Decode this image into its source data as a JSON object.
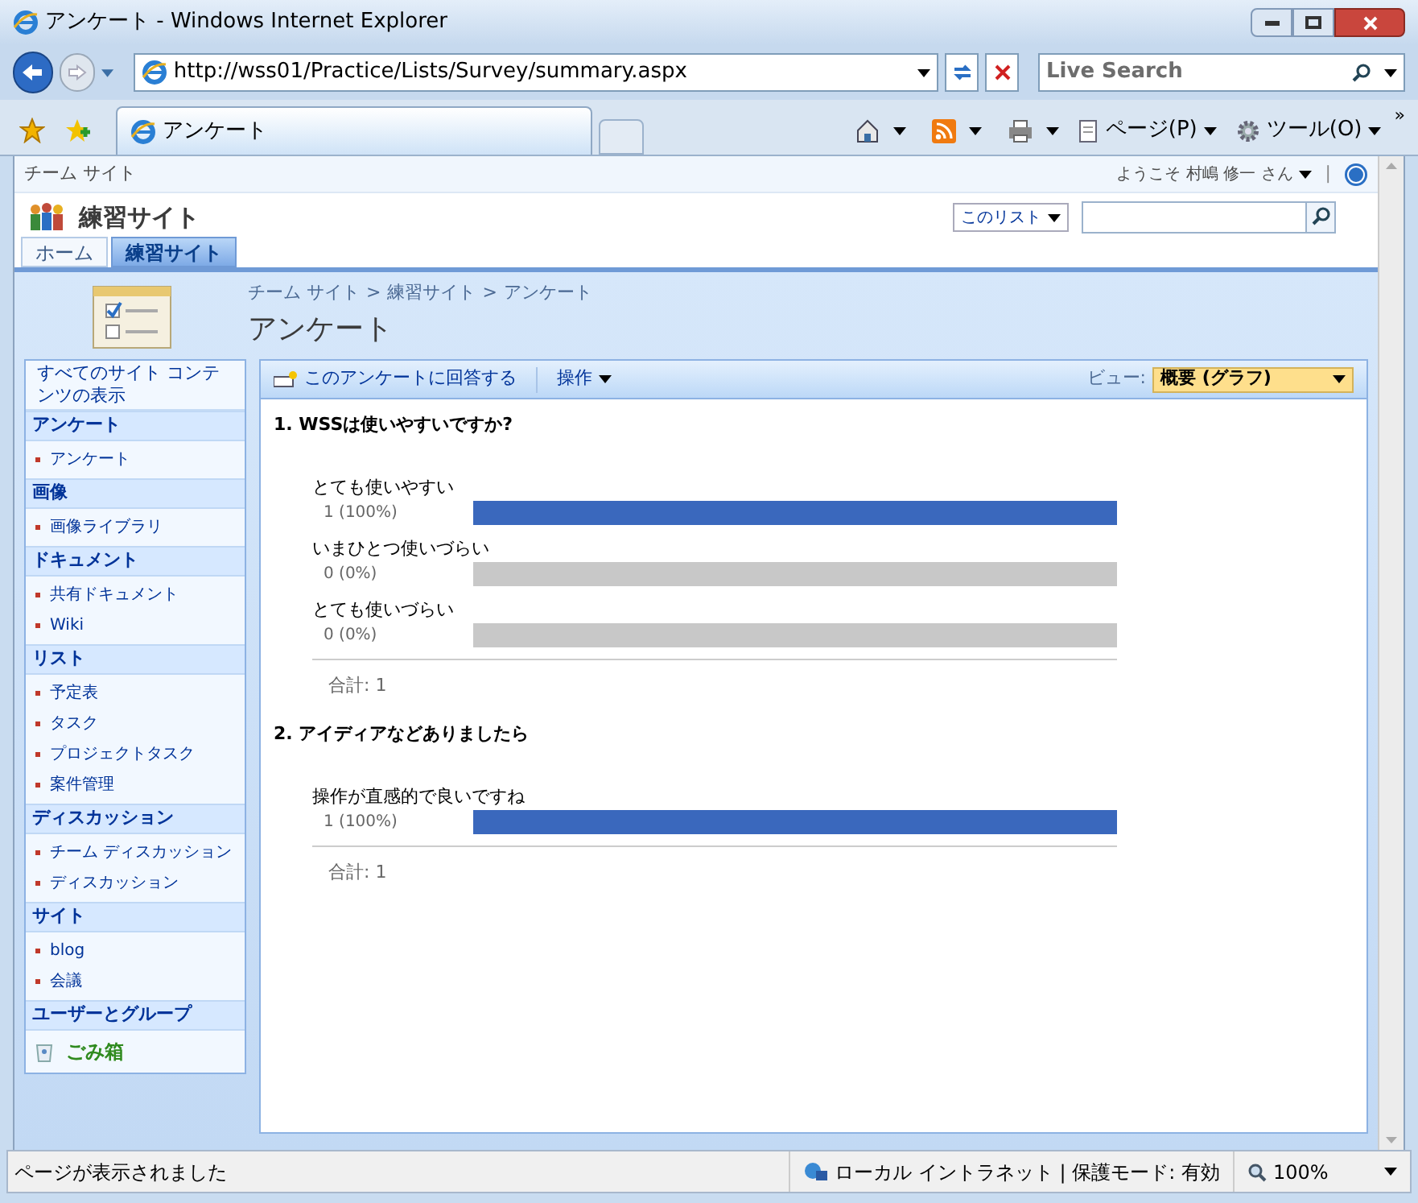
{
  "window": {
    "title": "アンケート - Windows Internet Explorer"
  },
  "browser": {
    "address": "http://wss01/Practice/Lists/Survey/summary.aspx",
    "search_placeholder": "Live Search",
    "tab": "アンケート",
    "page_menu": "ページ(P)",
    "tools_menu": "ツール(O)",
    "more": "»"
  },
  "site": {
    "top_link": "チーム サイト",
    "welcome": "ようこそ 村嶋 修一 さん",
    "welcome_separator": "|",
    "title": "練習サイト",
    "scope": "このリスト",
    "tabs": [
      {
        "label": "ホーム",
        "selected": false
      },
      {
        "label": "練習サイト",
        "selected": true
      }
    ],
    "breadcrumb": [
      "チーム サイト",
      "練習サイト",
      "アンケート"
    ],
    "separator": ">",
    "page_title": "アンケート"
  },
  "sidebar": {
    "view_all": "すべてのサイト コンテンツの表示",
    "sections": [
      {
        "heading": "アンケート",
        "items": [
          "アンケート"
        ]
      },
      {
        "heading": "画像",
        "items": [
          "画像ライブラリ"
        ]
      },
      {
        "heading": "ドキュメント",
        "items": [
          "共有ドキュメント",
          "Wiki"
        ]
      },
      {
        "heading": "リスト",
        "items": [
          "予定表",
          "タスク",
          "プロジェクトタスク",
          "案件管理"
        ]
      },
      {
        "heading": "ディスカッション",
        "items": [
          "チーム ディスカッション",
          "ディスカッション"
        ]
      },
      {
        "heading": "サイト",
        "items": [
          "blog",
          "会議"
        ]
      },
      {
        "heading": "ユーザーとグループ"
      }
    ],
    "recycle_bin": "ごみ箱"
  },
  "toolbar": {
    "respond": "このアンケートに回答する",
    "actions": "操作",
    "view_label": "ビュー:",
    "view_value": "概要 (グラフ)"
  },
  "questions": [
    {
      "title": "1. WSSは使いやすいですか?",
      "total": "合計: 1",
      "answers": [
        {
          "label": "とても使いやすい",
          "count": "1 (100%)",
          "level": 1
        },
        {
          "label": "いまひとつ使いづらい",
          "count": "0 (0%)",
          "level": 0
        },
        {
          "label": "とても使いづらい",
          "count": "0 (0%)",
          "level": 0
        }
      ]
    },
    {
      "title": "2. アイディアなどありましたら",
      "total": "合計: 1",
      "answers": [
        {
          "label": "操作が直感的で良いですね",
          "count": "1 (100%)",
          "level": 1
        }
      ]
    }
  ],
  "status_bar": {
    "text": "ページが表示されました",
    "zone": "ローカル イントラネット | 保護モード: 有効",
    "zoom": "100%"
  }
}
